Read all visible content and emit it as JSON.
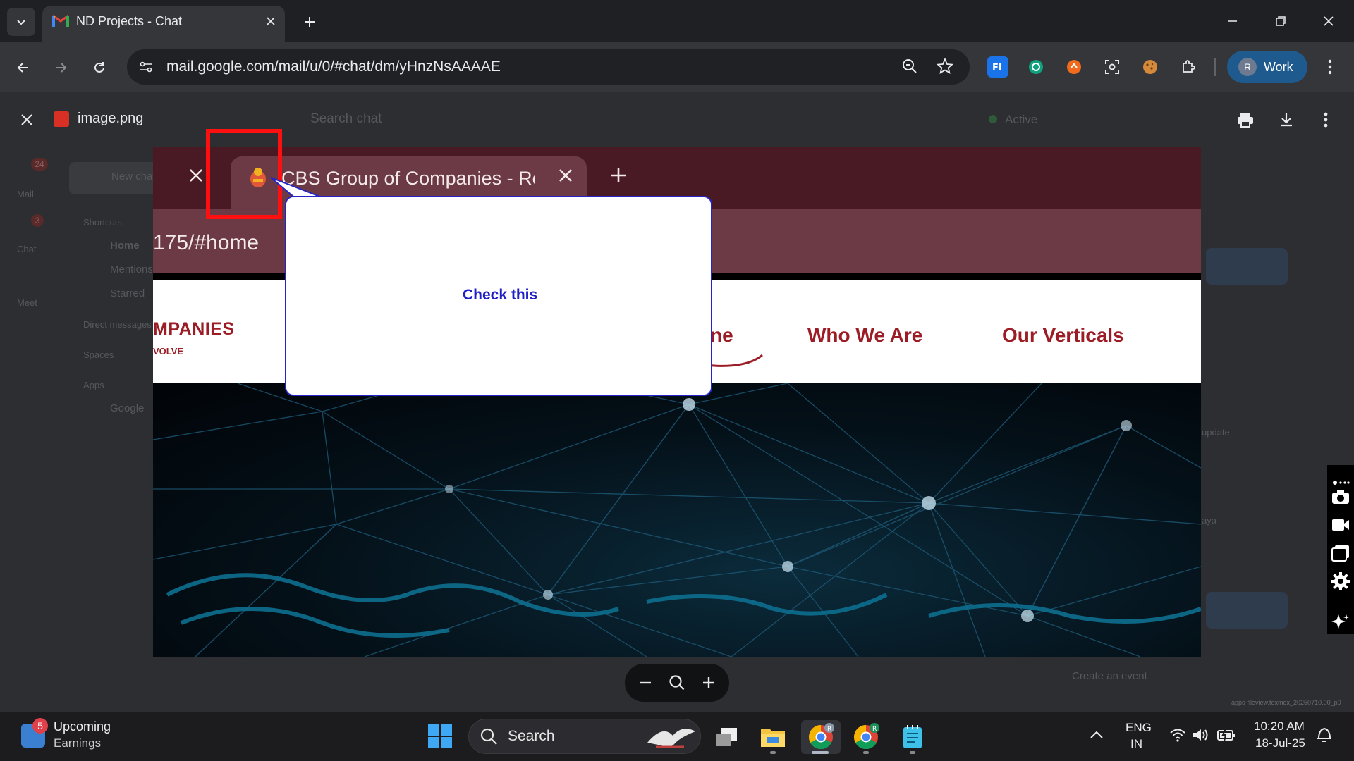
{
  "browser": {
    "tab_title": "ND Projects - Chat",
    "url": "mail.google.com/mail/u/0/#chat/dm/yHnzNsAAAAE",
    "profile_initial": "R",
    "profile_label": "Work"
  },
  "gmail_background": {
    "search_placeholder": "Search chat",
    "status": "Active",
    "new_chat": "New chat",
    "mail_badge": "24",
    "chat_badge": "3",
    "rail": [
      "Mail",
      "Chat",
      "Meet"
    ],
    "shortcuts": "Shortcuts",
    "nav": [
      "Home",
      "Mentions",
      "Starred"
    ],
    "sections": [
      "Direct messages",
      "Spaces",
      "Apps"
    ],
    "apps_item": "Google",
    "create_event": "Create an event",
    "update_label": "update",
    "aya_label": "aya"
  },
  "viewer": {
    "file_name": "image.png"
  },
  "screenshot": {
    "tab_title": "CBS Group of Companies - Revo",
    "url_fragment": "175/#home",
    "logo_text": "MPANIES",
    "logo_sub": "VOLVE",
    "nav_partial": "ne",
    "nav_links": [
      "Who We Are",
      "Our Verticals"
    ]
  },
  "annotation": {
    "callout_text": "Check this",
    "highlight_color": "#ff1010",
    "callout_border_color": "#2424c8"
  },
  "file_label": "apps-fileview.texmex_20250710.00_p0",
  "taskbar": {
    "weather_badge": "5",
    "weather_title": "Upcoming",
    "weather_sub": "Earnings",
    "search_label": "Search",
    "lang1": "ENG",
    "lang2": "IN",
    "time": "10:20 AM",
    "date": "18-Jul-25"
  }
}
